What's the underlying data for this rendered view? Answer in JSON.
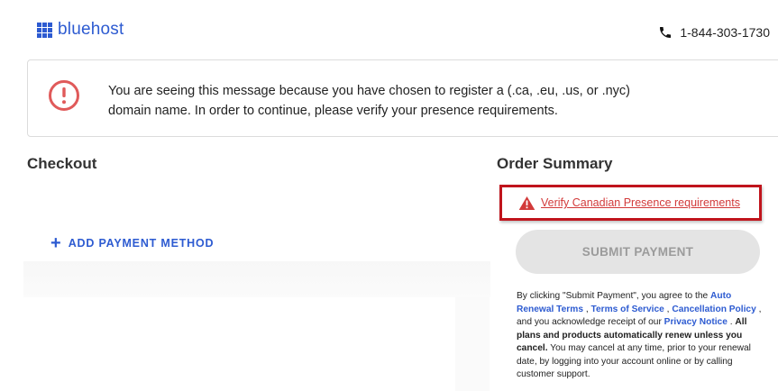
{
  "header": {
    "logo_text": "bluehost",
    "logo_color": "#2d5bd1",
    "phone_icon": "phone-icon",
    "phone_number": "1-844-303-1730"
  },
  "alert": {
    "icon": "exclamation-circle-icon",
    "icon_color": "#e05a5a",
    "line1": "You are seeing this message because you have chosen to register a (.ca, .eu, .us, or .nyc)",
    "line2": "domain name. In order to continue, please verify your presence requirements."
  },
  "checkout": {
    "title": "Checkout",
    "add_payment_icon": "plus-icon",
    "add_payment_label": "ADD PAYMENT METHOD"
  },
  "order_summary": {
    "title": "Order Summary",
    "warning_icon": "warning-triangle-icon",
    "warning_color": "#d23a3a",
    "highlight_color": "#c0141c",
    "verify_link": "Verify Canadian Presence requirements",
    "submit_label": "SUBMIT PAYMENT",
    "terms": {
      "t1": "By clicking \"Submit Payment\", you agree to the ",
      "link_auto_renewal": "Auto Renewal Terms",
      "t2": " , ",
      "link_tos": "Terms of Service",
      "t3": " , ",
      "link_cancellation": "Cancellation Policy",
      "t4": " , and you acknowledge receipt of our ",
      "link_privacy": "Privacy Notice",
      "t5": " . ",
      "bold": "All plans and products automatically renew unless you cancel.",
      "t6": " You may cancel at any time, prior to your renewal date, by logging into your account online or by calling customer support."
    }
  }
}
